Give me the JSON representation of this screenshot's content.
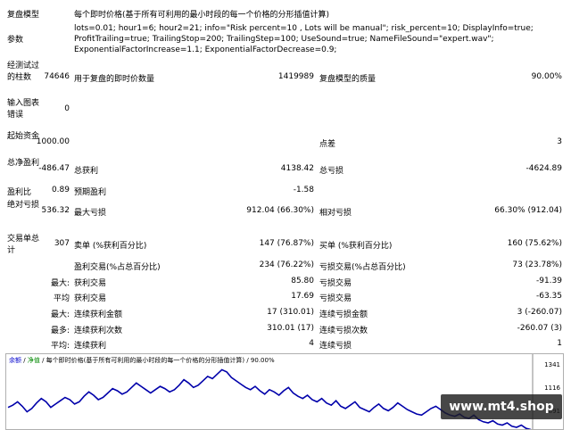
{
  "header": {
    "model_label": "复盘模型",
    "model_value": "每个即时价格(基于所有可利用的最小时段的每一个价格的分形插值计算)",
    "params_label": "参数",
    "params_value": "lots=0.01; hour1=6; hour2=21; info=\"Risk percent=10 , Lots will be manual\"; risk_percent=10; DisplayInfo=true; ProfitTrailing=true; TrailingStop=200; TrailingStep=100; UseSound=true; NameFileSound=\"expert.wav\"; ExponentialFactorIncrease=1.1; ExponentialFactorDecrease=0.9;"
  },
  "stats": {
    "bars_label": "经测试过的柱数",
    "bars_value": "74646",
    "ticks_label": "用于复盘的即时价数量",
    "ticks_value": "1419989",
    "quality_label": "复盘模型的质量",
    "quality_value": "90.00%",
    "errors_label": "输入图表错误",
    "errors_value": "0",
    "deposit_label": "起始资金",
    "deposit_value": "1000.00",
    "spread_label": "点差",
    "spread_value": "3",
    "net_label": "总净盈利",
    "net_value": "-486.47",
    "gross_profit_label": "总获利",
    "gross_profit_value": "4138.42",
    "gross_loss_label": "总亏损",
    "gross_loss_value": "-4624.89",
    "pf_label": "盈利比",
    "pf_value": "0.89",
    "expected_label": "预期盈利",
    "expected_value": "-1.58",
    "abs_dd_label": "绝对亏损",
    "abs_dd_value": "536.32",
    "max_dd_label": "最大亏损",
    "max_dd_value": "912.04 (66.30%)",
    "rel_dd_label": "相对亏损",
    "rel_dd_value": "66.30% (912.04)",
    "trades_label": "交易单总计",
    "trades_value": "307",
    "short_label": "卖单 (%获利百分比)",
    "short_value": "147 (76.87%)",
    "long_label": "买单 (%获利百分比)",
    "long_value": "160 (75.62%)",
    "profit_trades_label": "盈利交易(%占总百分比)",
    "profit_trades_value": "234 (76.22%)",
    "loss_trades_label": "亏损交易(%占总百分比)",
    "loss_trades_value": "73 (23.78%)",
    "largest_label": "最大:",
    "largest_profit_label": "获利交易",
    "largest_profit_value": "85.80",
    "largest_loss_label": "亏损交易",
    "largest_loss_value": "-91.39",
    "average_label": "平均",
    "average_profit_label": "获利交易",
    "average_profit_value": "17.69",
    "average_loss_label": "亏损交易",
    "average_loss_value": "-63.35",
    "max_label": "最大:",
    "max_cons_wins_label": "连续获利金额",
    "max_cons_wins_value": "17 (310.01)",
    "max_cons_losses_label": "连续亏损金额",
    "max_cons_losses_value": "3 (-260.07)",
    "most_label": "最多:",
    "most_cons_profit_label": "连续获利次数",
    "most_cons_profit_value": "310.01 (17)",
    "most_cons_loss_label": "连续亏损次数",
    "most_cons_loss_value": "-260.07 (3)",
    "avg_label": "平均:",
    "avg_cons_wins_label": "连续获利",
    "avg_cons_wins_value": "4",
    "avg_cons_losses_label": "连续亏损",
    "avg_cons_losses_value": "1"
  },
  "chart": {
    "header_balance": "余额",
    "header_equity": "净值",
    "header_rest": "每个即时价格(基于所有可利用的最小时段的每一个价格的分形插值计算) / 90.00%",
    "y_labels": [
      "1341",
      "1116",
      "891"
    ]
  },
  "chart_data": {
    "type": "line",
    "series": [
      {
        "name": "余额",
        "color": "#0000aa",
        "values": [
          1000,
          1020,
          1050,
          1010,
          960,
          990,
          1040,
          1080,
          1050,
          1000,
          1030,
          1060,
          1090,
          1070,
          1030,
          1050,
          1100,
          1140,
          1110,
          1070,
          1090,
          1130,
          1170,
          1150,
          1120,
          1140,
          1180,
          1220,
          1190,
          1160,
          1130,
          1160,
          1190,
          1170,
          1140,
          1160,
          1200,
          1250,
          1220,
          1180,
          1200,
          1240,
          1280,
          1260,
          1300,
          1340,
          1320,
          1270,
          1240,
          1210,
          1180,
          1160,
          1190,
          1150,
          1120,
          1160,
          1140,
          1110,
          1150,
          1180,
          1130,
          1100,
          1080,
          1110,
          1070,
          1050,
          1080,
          1040,
          1020,
          1060,
          1010,
          990,
          1020,
          1050,
          1000,
          980,
          960,
          1000,
          1030,
          990,
          970,
          1000,
          1040,
          1010,
          980,
          960,
          940,
          930,
          960,
          990,
          1010,
          980,
          950,
          930,
          920,
          940,
          910,
          900,
          930,
          890,
          870,
          860,
          880,
          850,
          840,
          860,
          830,
          820,
          840,
          810,
          800
        ]
      }
    ],
    "y_ticks": [
      1341,
      1116,
      891
    ],
    "ylim": [
      820,
      1400
    ],
    "grid": false
  }
}
